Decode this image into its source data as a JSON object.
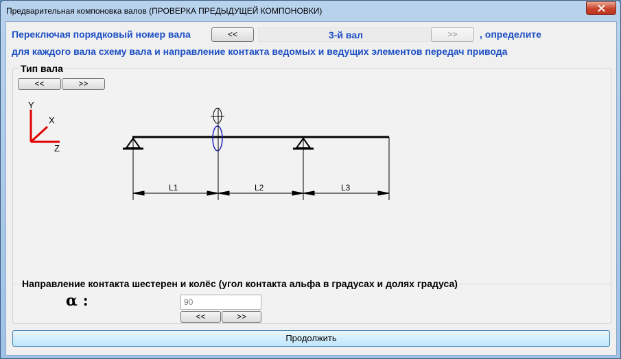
{
  "window": {
    "title": "Предварительная компоновка валов (ПРОВЕРКА ПРЕДЫДУЩЕЙ КОМПОНОВКИ)"
  },
  "instructions": {
    "line1_prefix": "Переключая порядковый номер вала",
    "line1_suffix": ", определите",
    "line2": "для каждого вала схему вала и направление контакта ведомых и ведущих элементов передач привода"
  },
  "shaft_nav": {
    "prev_label": "<<",
    "current": "3-й вал",
    "next_label": ">>"
  },
  "shaft_type": {
    "group_title": "Тип вала",
    "prev_label": "<<",
    "next_label": ">>",
    "axes": {
      "y": "Y",
      "x": "X",
      "z": "Z"
    },
    "dimensions": [
      "L1",
      "L2",
      "L3"
    ]
  },
  "contact": {
    "title": "Направление контакта шестерен и колёс (угол контакта альфа в градусах и долях градуса)",
    "alpha_label": "α :",
    "angle_value": "90",
    "prev_label": "<<",
    "next_label": ">>"
  },
  "footer": {
    "continue_label": "Продолжить"
  },
  "colors": {
    "accent_text": "#1c4fc4",
    "axis": "#e00000",
    "gear": "#2020c0"
  }
}
